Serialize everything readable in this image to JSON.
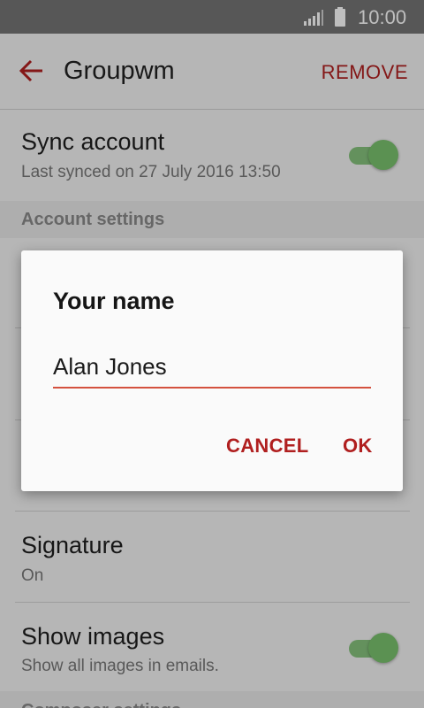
{
  "status_bar": {
    "time": "10:00",
    "signal_icon": "signal-icon",
    "battery_icon": "battery-icon"
  },
  "app_bar": {
    "back_icon": "back-arrow-icon",
    "title": "Groupwm",
    "remove_label": "REMOVE"
  },
  "sync_account": {
    "title": "Sync account",
    "subtitle": "Last synced on 27 July 2016  13:50",
    "enabled": true
  },
  "section_header": {
    "label": "Account settings"
  },
  "signature": {
    "title": "Signature",
    "subtitle": "On"
  },
  "show_images": {
    "title": "Show images",
    "subtitle": "Show all images in emails.",
    "enabled": true
  },
  "next_section_header": {
    "label": "Composer settings"
  },
  "dialog": {
    "title": "Your name",
    "input_value": "Alan Jones",
    "cancel_label": "CANCEL",
    "ok_label": "OK"
  },
  "colors": {
    "accent": "#b01f1f",
    "toggle_on": "#7ac26e",
    "input_underline": "#d4513f"
  }
}
